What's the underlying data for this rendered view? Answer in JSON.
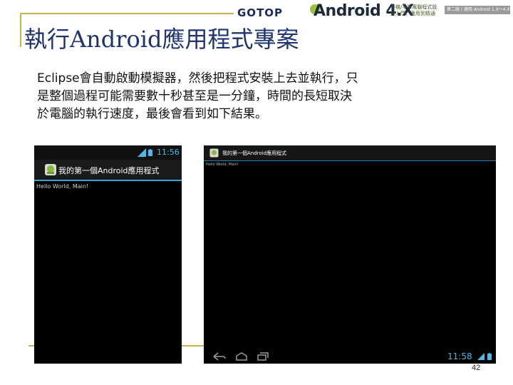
{
  "header": {
    "publisher": "GOTOP",
    "book_title_main": "Android",
    "book_title_version": "4.X",
    "book_subtitle": "手機/平板電腦程式設計入門、應用到精通",
    "book_tag": "第二版 | 適用 Android 1.X～4.X"
  },
  "slide": {
    "title": "執行Android應用程式專案",
    "body_lines": [
      "Eclipse會自動啟動模擬器，然後把程式安裝上去並執行，只",
      "是整個過程可能需要數十秒甚至是一分鐘，時間的長短取決",
      "於電腦的執行速度，最後會看到如下結果。"
    ],
    "page_number": "42"
  },
  "phone": {
    "clock": "11:56",
    "app_title": "我的第一個Android應用程式",
    "content_text": "Hello World, Main!"
  },
  "tablet": {
    "app_title": "我的第一個Android應用程式",
    "content_text": "Hello World, Main!",
    "clock": "11:58"
  },
  "colors": {
    "title": "#1e3470",
    "frame": "#c8b34a",
    "android_accent": "#33a8d8"
  }
}
